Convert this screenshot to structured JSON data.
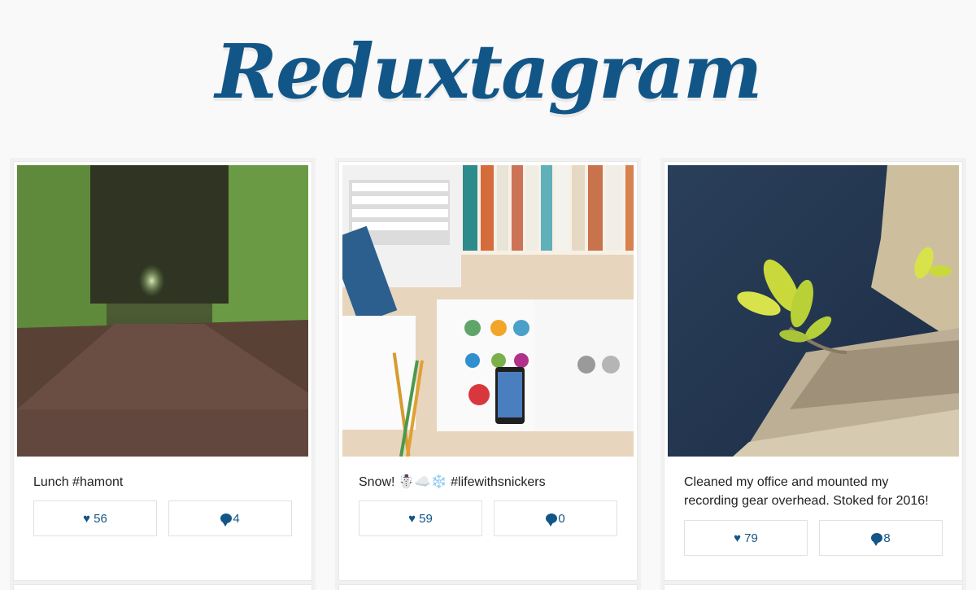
{
  "app": {
    "title": "Reduxtagram",
    "accent": "#125688"
  },
  "posts": [
    {
      "caption": "Lunch #hamont",
      "likes": "♥ 56",
      "comments": "4"
    },
    {
      "caption": "Snow! ☃️☁️❄️ #lifewithsnickers",
      "likes": "♥ 59",
      "comments": "0"
    },
    {
      "caption": "Cleaned my office and mounted my recording gear overhead. Stoked for 2016!",
      "likes": "♥ 79",
      "comments": "8"
    }
  ],
  "icons": {
    "like": "heart-icon",
    "comment": "speech-bubble-icon"
  }
}
